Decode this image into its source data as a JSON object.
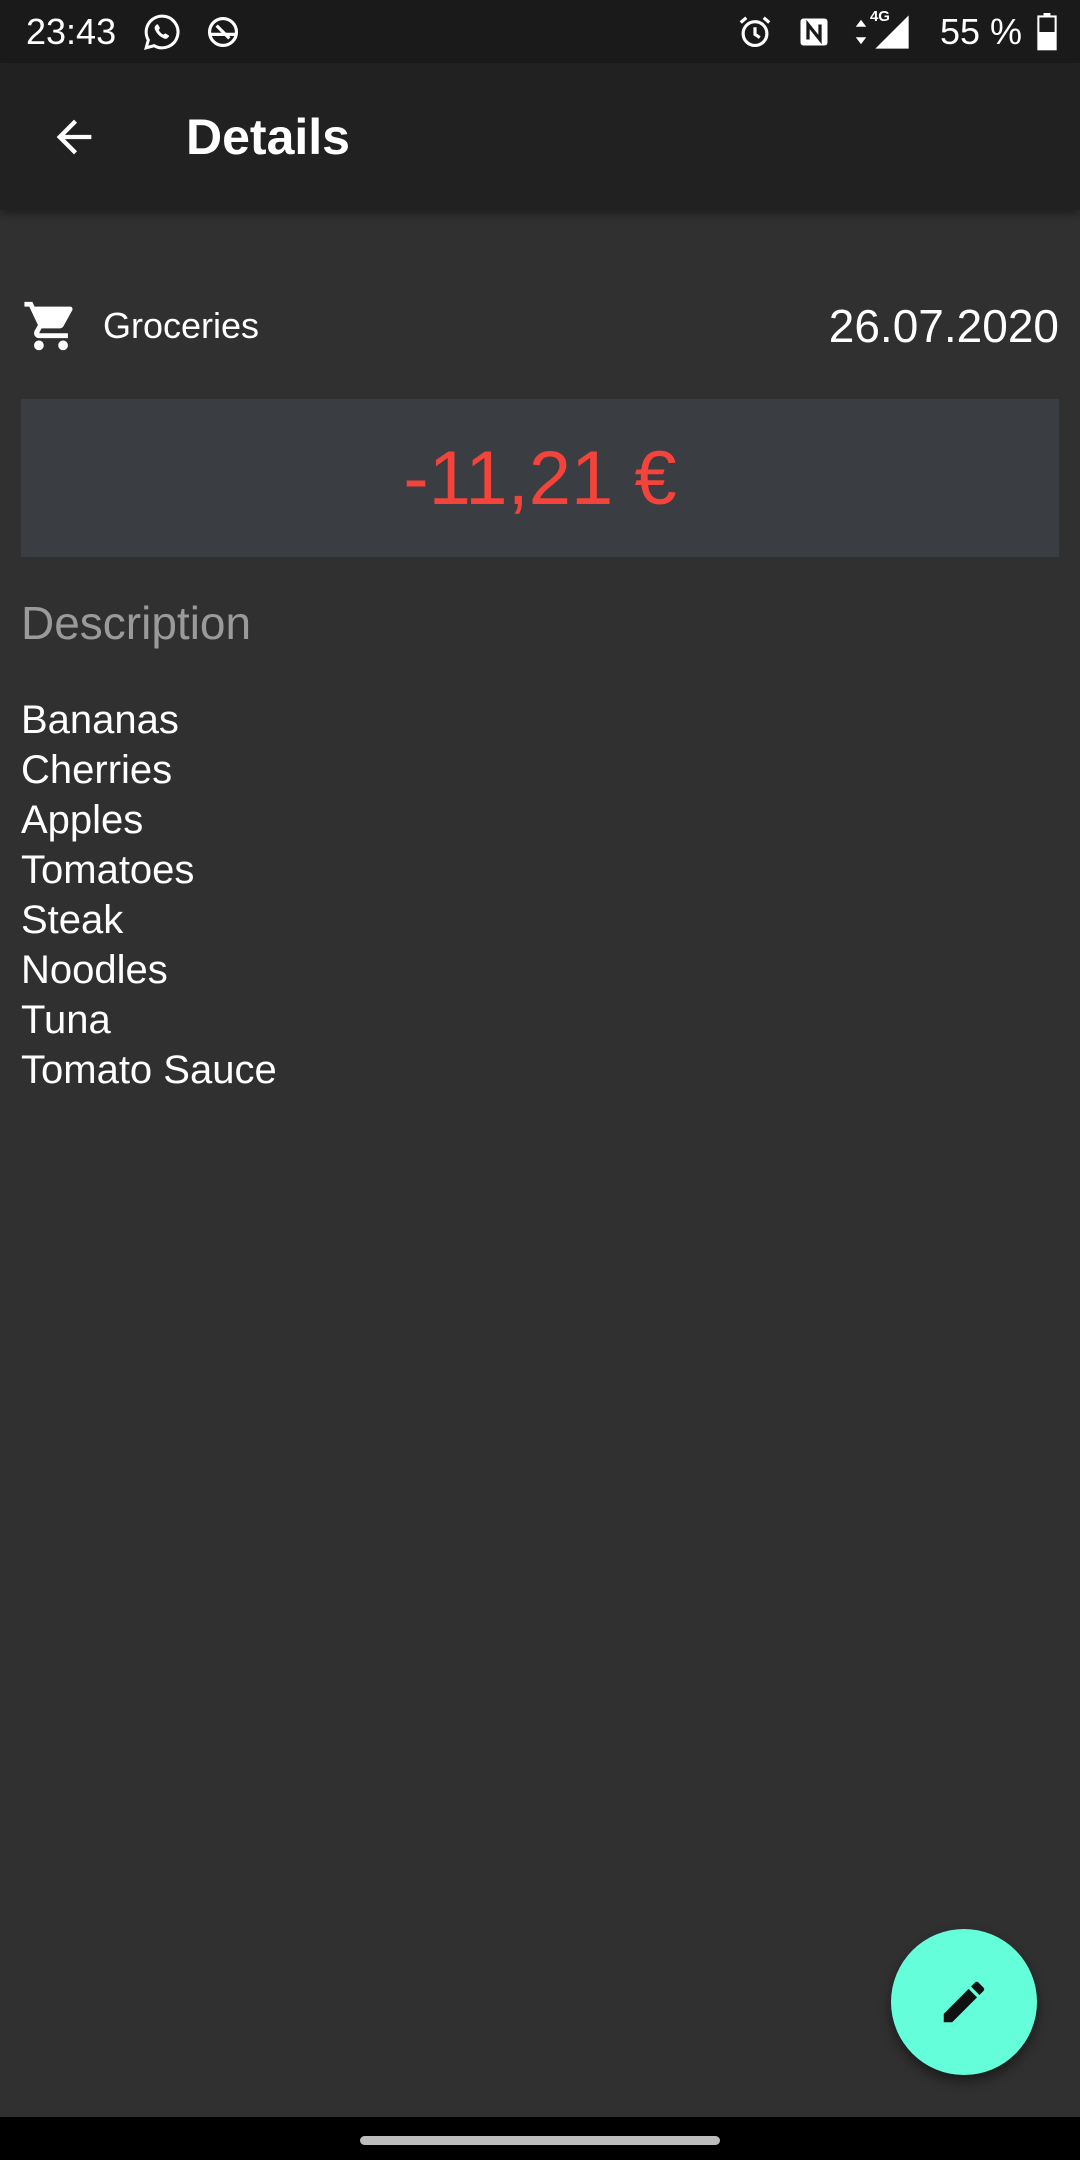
{
  "status_bar": {
    "time": "23:43",
    "battery_text": "55 %",
    "network_label": "4G",
    "icons": [
      "whatsapp-icon",
      "app-notification-icon",
      "alarm-icon",
      "nfc-icon",
      "data-arrows-icon",
      "signal-icon",
      "battery-icon"
    ]
  },
  "app_bar": {
    "title": "Details",
    "back_icon": "arrow-back-icon"
  },
  "transaction": {
    "category_icon": "shopping-cart-icon",
    "category": "Groceries",
    "date": "26.07.2020",
    "amount": "-11,21 €"
  },
  "description": {
    "heading": "Description",
    "items": [
      "Bananas",
      "Cherries",
      "Apples",
      "Tomatoes",
      "Steak",
      "Noodles",
      "Tuna",
      "Tomato Sauce"
    ]
  },
  "fab": {
    "icon": "edit-pencil-icon"
  },
  "colors": {
    "background": "#303030",
    "app_bar": "#212121",
    "amount_negative": "#f4433b",
    "amount_box": "#3a3d41",
    "fab": "#64ffda",
    "muted_text": "#9a9a9a"
  }
}
